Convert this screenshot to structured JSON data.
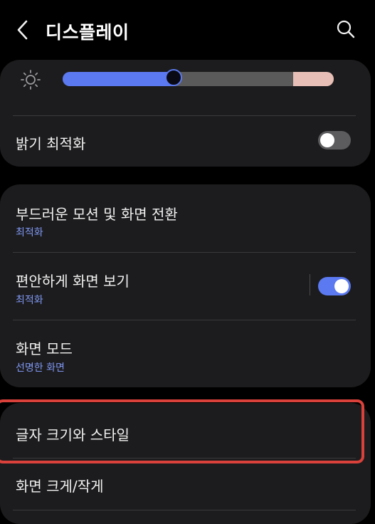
{
  "header": {
    "back_icon": "chevron-left-icon",
    "title": "디스플레이",
    "search_icon": "search-icon"
  },
  "brightness": {
    "icon": "sun-icon",
    "level": 0.41,
    "extra_brightness_start": 0.85,
    "colors": {
      "fill": "#5b79f0",
      "track": "#5a5a5a",
      "extra": "#e8bfb6"
    }
  },
  "adaptive_brightness": {
    "label": "밝기 최적화",
    "enabled": false
  },
  "motion_smoothness": {
    "label": "부드러운 모션 및 화면 전환",
    "value": "최적화"
  },
  "eye_comfort": {
    "label": "편안하게 화면 보기",
    "value": "최적화",
    "enabled": true
  },
  "screen_mode": {
    "label": "화면 모드",
    "value": "선명한 화면"
  },
  "font_size_style": {
    "label": "글자 크기와 스타일"
  },
  "screen_zoom": {
    "label": "화면 크게/작게"
  },
  "colors": {
    "accent": "#5b79f0",
    "card": "#1c1c1e",
    "background": "#000000",
    "highlight": "#d9413a"
  }
}
